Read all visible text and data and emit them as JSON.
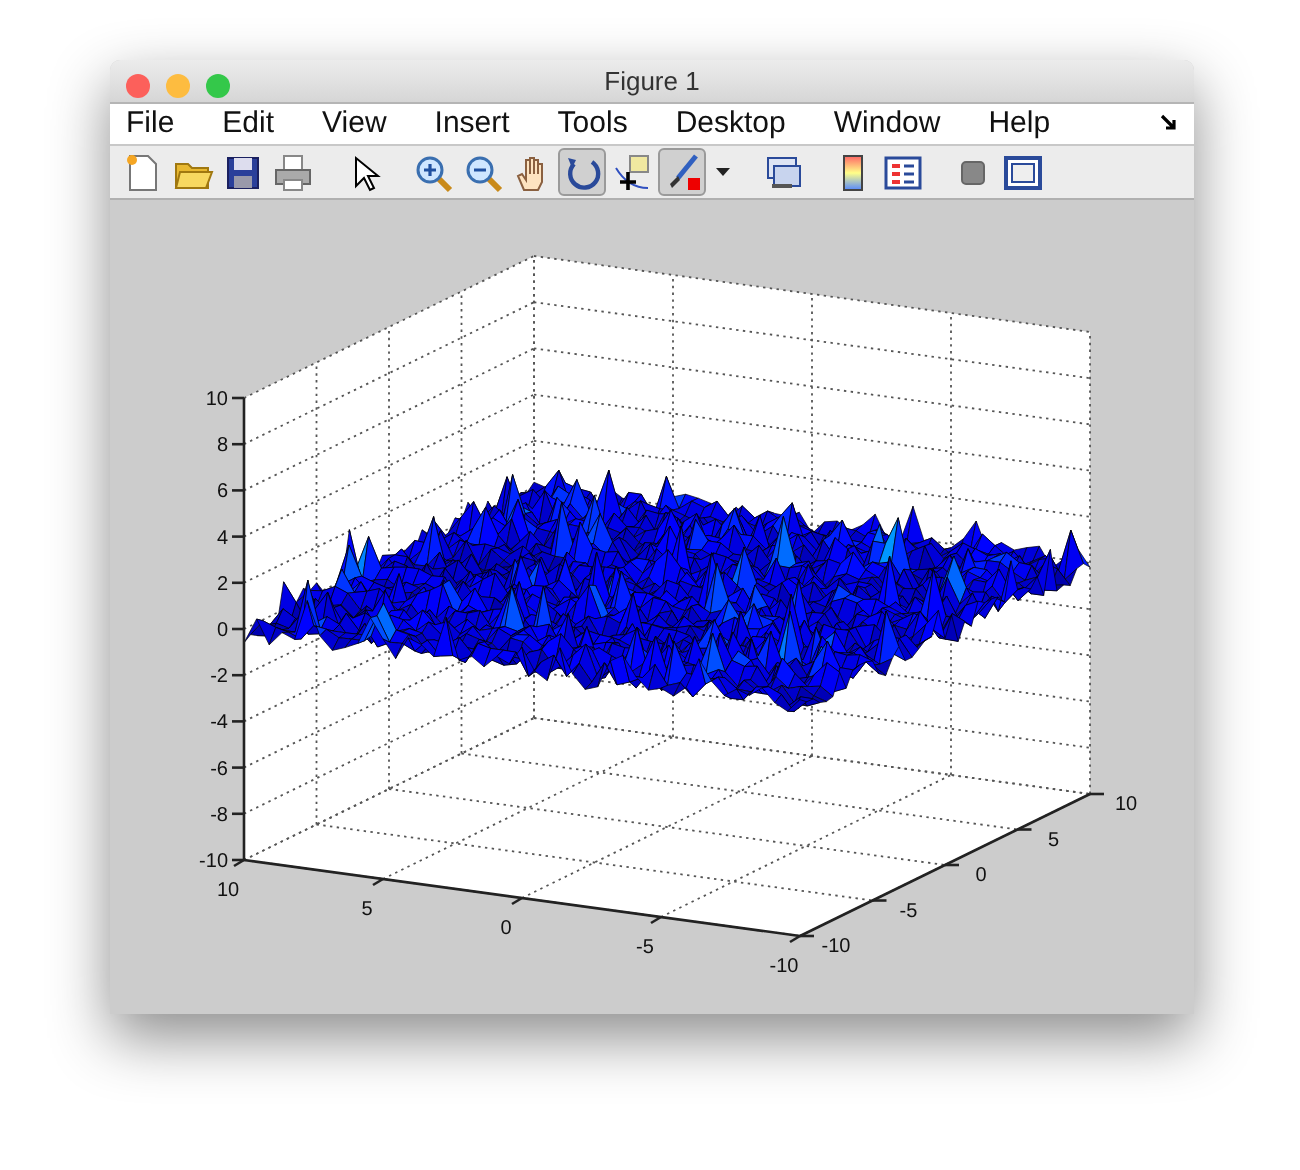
{
  "window": {
    "title": "Figure 1",
    "buttons": [
      {
        "kind": "close"
      },
      {
        "kind": "minimize"
      },
      {
        "kind": "zoom"
      }
    ]
  },
  "menu": [
    "File",
    "Edit",
    "View",
    "Insert",
    "Tools",
    "Desktop",
    "Window",
    "Help"
  ],
  "toolbar": [
    [
      {
        "kind": "new",
        "pressed": false
      },
      {
        "kind": "open",
        "pressed": false
      },
      {
        "kind": "save",
        "pressed": false
      },
      {
        "kind": "print",
        "pressed": false
      }
    ],
    [
      {
        "kind": "pointer",
        "pressed": false
      }
    ],
    [
      {
        "kind": "zoom-in",
        "pressed": false
      },
      {
        "kind": "zoom-out",
        "pressed": false
      },
      {
        "kind": "pan",
        "pressed": false
      },
      {
        "kind": "rotate",
        "pressed": true
      },
      {
        "kind": "data-cursor",
        "pressed": false
      },
      {
        "kind": "brush",
        "pressed": true
      },
      {
        "kind": "caret",
        "pressed": false
      }
    ],
    [
      {
        "kind": "link",
        "pressed": false
      }
    ],
    [
      {
        "kind": "colorbar",
        "pressed": false
      },
      {
        "kind": "legend",
        "pressed": false
      }
    ],
    [
      {
        "kind": "hide",
        "pressed": false
      },
      {
        "kind": "dock",
        "pressed": false
      }
    ]
  ],
  "plot": {
    "z_ticks": [
      "10",
      "8",
      "6",
      "4",
      "2",
      "0",
      "-2",
      "-4",
      "-6",
      "-8",
      "-10"
    ],
    "x_ticks": [
      "10",
      "5",
      "0",
      "-5",
      "-10"
    ],
    "y_ticks": [
      "-10",
      "-5",
      "0",
      "5",
      "10"
    ]
  }
}
